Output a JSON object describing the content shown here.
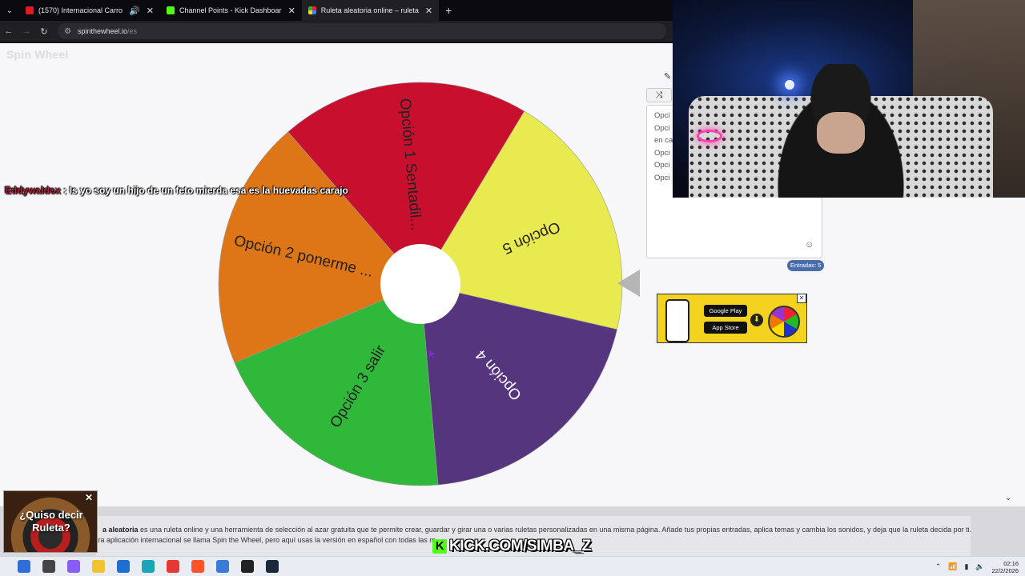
{
  "browser": {
    "tabs": [
      {
        "title": "(1570) Internacional Carro",
        "color": "#e01b24",
        "active": false
      },
      {
        "title": "Channel Points - Kick Dashboar",
        "color": "#53fc18",
        "active": false
      },
      {
        "title": "Ruleta aleatoria online – ruleta",
        "color": "#3b82f6",
        "active": true
      }
    ],
    "url_host": "spinthewheel.io",
    "url_path": "/es"
  },
  "page": {
    "logo": "Spin Wheel"
  },
  "chat": {
    "user": "Eddywaldox",
    "message": ": Is yo soy un hijo de un feto mierda esa es la huevadas carajo"
  },
  "wheel": {
    "segments": [
      {
        "label": "Opción 1 Sentadil...",
        "color": "#c8102e"
      },
      {
        "label": "Opción 5",
        "color": "#e8ea4f"
      },
      {
        "label": "Opción 4",
        "color": "#54357e"
      },
      {
        "label": "Opción 3 salir",
        "color": "#30b83a"
      },
      {
        "label": "Opción 2 ponerme ...",
        "color": "#de7516"
      }
    ]
  },
  "entries_panel": {
    "lines": [
      "Opci",
      "Opci",
      "en ca",
      "Opci",
      "Opci",
      "Opci"
    ],
    "count_label": "Entradas: 5"
  },
  "ad": {
    "google_play": "Google Play",
    "app_store": "App Store"
  },
  "description": {
    "bold": "a aleatoria",
    "line1_rest": " es una ruleta online y una herramienta de selección al azar gratuita que te permite crear, guardar y girar una o varias ruletas personalizadas en una misma página. Añade tus propias entradas, aplica temas y cambia los sonidos, y deja que la ruleta decida por ti.",
    "line2": "tra aplicación internacional se llama Spin the Wheel, pero aquí usas la versión en español con todas las m"
  },
  "promo": {
    "text": "¿Quiso decir Ruleta?"
  },
  "stream_overlay": {
    "kick_url": "KICK.COM/SIMBA_Z"
  },
  "taskbar": {
    "time": "02:16",
    "date": "22/2/2026",
    "icons": [
      {
        "name": "windows-start-icon",
        "color": "#2d6fd6"
      },
      {
        "name": "search-icon",
        "color": "#444444"
      },
      {
        "name": "copilot-icon",
        "color": "#8a5cf6"
      },
      {
        "name": "file-explorer-icon",
        "color": "#f2c230"
      },
      {
        "name": "store-icon",
        "color": "#1f6fd1"
      },
      {
        "name": "edge-icon",
        "color": "#1aa6b7"
      },
      {
        "name": "chrome-icon",
        "color": "#e53935"
      },
      {
        "name": "brave-icon",
        "color": "#fb542b"
      },
      {
        "name": "app-icon",
        "color": "#3a7bd5"
      },
      {
        "name": "obs-icon",
        "color": "#222222"
      },
      {
        "name": "steam-icon",
        "color": "#1b2838"
      }
    ]
  }
}
